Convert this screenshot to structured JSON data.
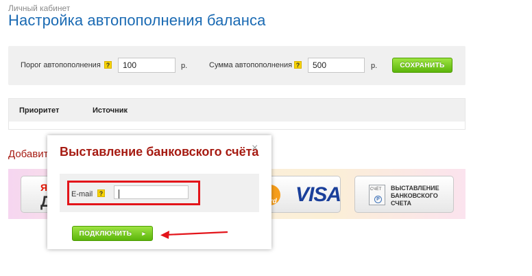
{
  "breadcrumb": "Личный кабинет",
  "title": "Настройка автопополнения баланса",
  "settings": {
    "threshold_label": "Порог автопополнения",
    "threshold_value": "100",
    "threshold_currency": "р.",
    "amount_label": "Сумма автопополнения",
    "amount_value": "500",
    "amount_currency": "р.",
    "help": "?",
    "save_label": "СОХРАНИТЬ"
  },
  "table": {
    "columns": [
      "Приоритет",
      "Источник"
    ]
  },
  "add_title": "Добавит",
  "methods": {
    "yandex_partial_top": "Я",
    "yandex_partial_bottom": "Д",
    "mastercard_text": "Card",
    "visa_text": "VISA",
    "bill_doc_label": "СЧЁТ",
    "bill_doc_symbol": "Р",
    "bill_label": "ВЫСТАВЛЕНИЕ БАНКОВСКОГО СЧЕТА"
  },
  "modal": {
    "title": "Выставление банковского счёта",
    "close": "×",
    "email_label": "E-mail",
    "help": "?",
    "email_value": "",
    "connect_label": "ПОДКЛЮЧИТЬ",
    "connect_arrow": "▸"
  },
  "colors": {
    "title_blue": "#1a6ab3",
    "accent_red": "#a61b12",
    "button_green": "#5bb50b",
    "highlight_red": "#e3141a"
  }
}
